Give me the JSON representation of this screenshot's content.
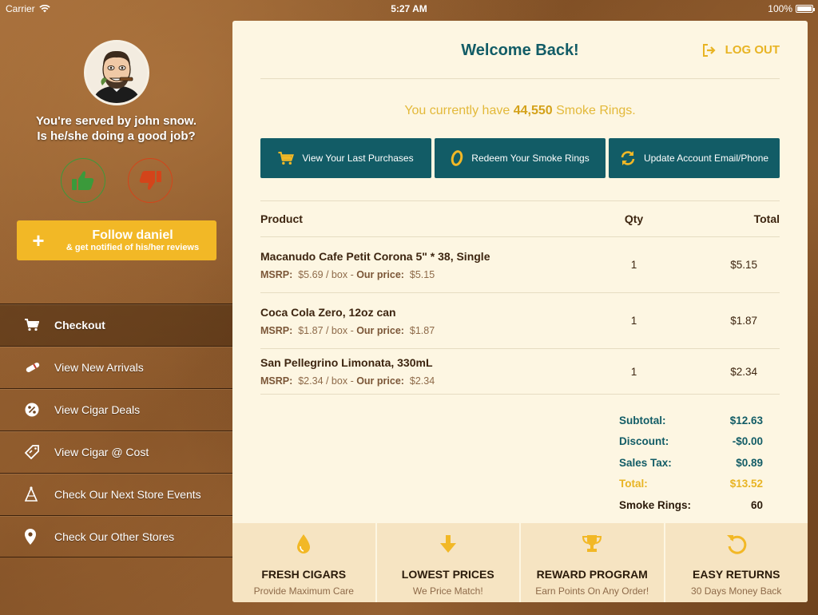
{
  "status_bar": {
    "carrier": "Carrier",
    "time": "5:27 AM",
    "battery": "100%"
  },
  "sidebar": {
    "served_line1": "You're served by john snow.",
    "served_line2": "Is he/she doing a good job?",
    "follow_title": "Follow daniel",
    "follow_subtitle": "& get notified of his/her reviews",
    "follow_plus": "+",
    "menu": [
      {
        "label": "Checkout",
        "icon": "cart-icon",
        "active": true
      },
      {
        "label": "View New Arrivals",
        "icon": "cigar-icon"
      },
      {
        "label": "View Cigar Deals",
        "icon": "percent-icon"
      },
      {
        "label": "View Cigar @ Cost",
        "icon": "tag-icon"
      },
      {
        "label": "Check Our Next Store Events",
        "icon": "party-hat-icon"
      },
      {
        "label": "Check Our Other Stores",
        "icon": "map-pin-icon"
      }
    ]
  },
  "main": {
    "welcome": "Welcome Back!",
    "logout": "LOG OUT",
    "points_prefix": "You currently have",
    "points_value": "44,550",
    "points_suffix": "Smoke Rings.",
    "actions": [
      {
        "label": "View Your Last Purchases",
        "icon": "cart-icon"
      },
      {
        "label": "Redeem Your Smoke Rings",
        "icon": "ring-icon"
      },
      {
        "label": "Update Account Email/Phone",
        "icon": "refresh-icon"
      }
    ],
    "table": {
      "headers": {
        "product": "Product",
        "qty": "Qty",
        "total": "Total"
      },
      "rows": [
        {
          "name": "Macanudo Cafe Petit Corona 5\" * 38, Single",
          "msrp_label": "MSRP:",
          "msrp": "$5.69 / box",
          "our_label": "Our price:",
          "our": "$5.15",
          "qty": "1",
          "total": "$5.15"
        },
        {
          "name": "Coca Cola Zero, 12oz can",
          "msrp_label": "MSRP:",
          "msrp": "$1.87 / box",
          "our_label": "Our price:",
          "our": "$1.87",
          "qty": "1",
          "total": "$1.87"
        },
        {
          "name": "San Pellegrino Limonata, 330mL",
          "msrp_label": "MSRP:",
          "msrp": "$2.34 / box",
          "our_label": "Our price:",
          "our": "$2.34",
          "qty": "1",
          "total": "$2.34"
        }
      ]
    },
    "summary": {
      "subtotal_label": "Subtotal:",
      "subtotal": "$12.63",
      "discount_label": "Discount:",
      "discount": "-$0.00",
      "tax_label": "Sales Tax:",
      "tax": "$0.89",
      "total_label": "Total:",
      "total": "$13.52",
      "rings_label": "Smoke Rings:",
      "rings": "60"
    },
    "features": [
      {
        "title": "FRESH CIGARS",
        "subtitle": "Provide Maximum Care",
        "icon": "drop-icon"
      },
      {
        "title": "LOWEST PRICES",
        "subtitle": "We Price Match!",
        "icon": "arrow-down-icon"
      },
      {
        "title": "REWARD PROGRAM",
        "subtitle": "Earn Points On Any Order!",
        "icon": "trophy-icon"
      },
      {
        "title": "EASY RETURNS",
        "subtitle": "30 Days Money Back",
        "icon": "undo-icon"
      }
    ]
  },
  "colors": {
    "teal": "#125c66",
    "gold": "#f2b826",
    "panel": "#fdf6e2",
    "thumb_up": "#3b9a3b",
    "thumb_down": "#d4441a"
  }
}
